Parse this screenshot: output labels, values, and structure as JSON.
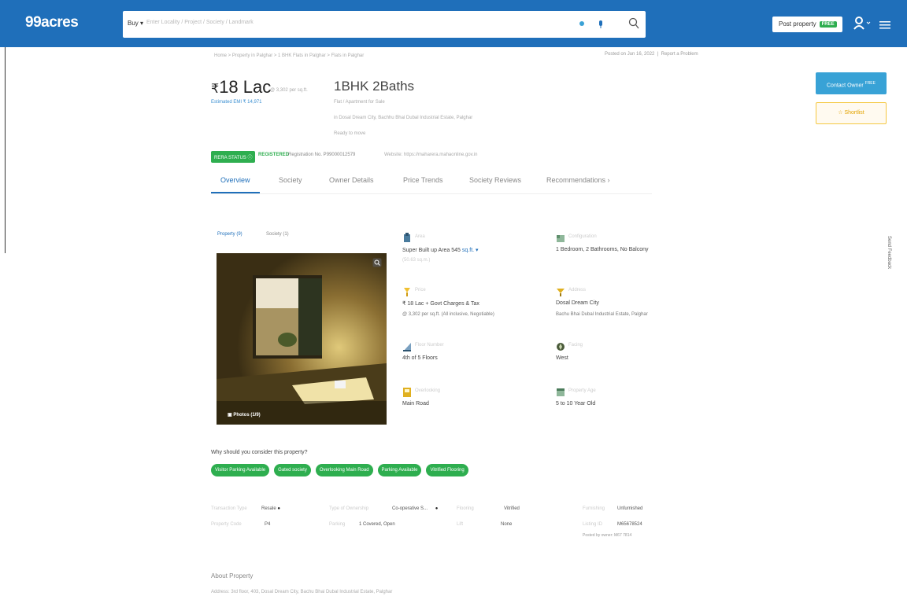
{
  "header": {
    "logo": "99acres",
    "search_mode": "Buy",
    "search_placeholder": "Enter Locality / Project / Society / Landmark",
    "post_property_label": "Post property",
    "post_property_badge": "FREE"
  },
  "breadcrumbs": "Home > Property in Palghar > 1 BHK Flats in Palghar > Flats in Palghar",
  "posted_info": "Posted on Jun 16, 2022",
  "posted_link": "Report a Problem",
  "listing": {
    "currency_symbol": "₹",
    "price": "18 Lac",
    "price_per_sqft": "@ 3,302 per sq.ft.",
    "emi": "Estimated EMI ₹ 14,971",
    "configuration": "1BHK 2Baths",
    "type": "Flat / Apartment for Sale",
    "location": "in Dosal Dream City, Bachhu Bhai Dubal Industrial Estate, Palghar",
    "possession": "Ready to move",
    "status_badge": "RERA STATUS",
    "rera_status": "REGISTERED",
    "registration": "Registration No. P99000012579",
    "website": "Website: https://maharera.mahaonline.gov.in"
  },
  "actions": {
    "contact_label": "Contact Owner",
    "contact_badge": "FREE",
    "shortlist_label": "Shortlist"
  },
  "tabs": [
    "Overview",
    "Society",
    "Owner Details",
    "Price Trends",
    "Society Reviews",
    "Recommendations"
  ],
  "subtabs": [
    "Property (9)",
    "Society (1)"
  ],
  "photo_label": "Photos (1/9)",
  "facts": [
    {
      "label": "Area",
      "value": "Super Built up Area 545",
      "unit": "sq.ft.",
      "sub": "(50.63 sq.m.)"
    },
    {
      "label": "Configuration",
      "value": "1 Bedroom, 2 Bathrooms, No Balcony",
      "unit": "",
      "sub": ""
    },
    {
      "label": "Price",
      "value": "₹ 18 Lac + Govt Charges & Tax",
      "unit": "",
      "sub": "@ 3,302 per sq.ft. (All inclusive, Negotiable)"
    },
    {
      "label": "Address",
      "value": "Dosal Dream City",
      "unit": "",
      "sub": "Bachu Bhai Dubal Industrial Estate, Palghar"
    },
    {
      "label": "Floor Number",
      "value": "4th of 5 Floors",
      "unit": "",
      "sub": ""
    },
    {
      "label": "Facing",
      "value": "West",
      "unit": "",
      "sub": ""
    },
    {
      "label": "Overlooking",
      "value": "Main Road",
      "unit": "",
      "sub": ""
    },
    {
      "label": "Property Age",
      "value": "5 to 10 Year Old",
      "unit": "",
      "sub": ""
    }
  ],
  "why_consider": {
    "title": "Why should you consider this property?",
    "chips": [
      "Visitor Parking Available",
      "Gated society",
      "Overlooking Main Road",
      "Parking Available",
      "Vitrified Flooring"
    ]
  },
  "details": [
    {
      "label": "Transaction Type",
      "value": "Resale"
    },
    {
      "label": "Type of Ownership",
      "value": "Co-operative S..."
    },
    {
      "label": "Flooring",
      "value": "Vitrified"
    },
    {
      "label": "Furnishing",
      "value": "Unfurnished"
    },
    {
      "label": "Property Code",
      "value": "P4"
    },
    {
      "label": "Parking",
      "value": "1 Covered, Open"
    },
    {
      "label": "Lift",
      "value": "None"
    },
    {
      "label": "Listing ID",
      "value": "M65678524"
    },
    {
      "label": "",
      "value": "Posted by owner: M67 7814"
    }
  ],
  "about": {
    "title": "About Property",
    "address": "Address: 3rd floor, 403, Dosal Dream City, Bachu Bhai Dubal Industrial Estate, Palghar"
  },
  "feedback_label": "Send Feedback",
  "colors": {
    "header_blue": "#1f6fba",
    "green": "#2eae4f",
    "contact_blue": "#38a2d6",
    "shortlist_yellow": "#f5c842"
  }
}
